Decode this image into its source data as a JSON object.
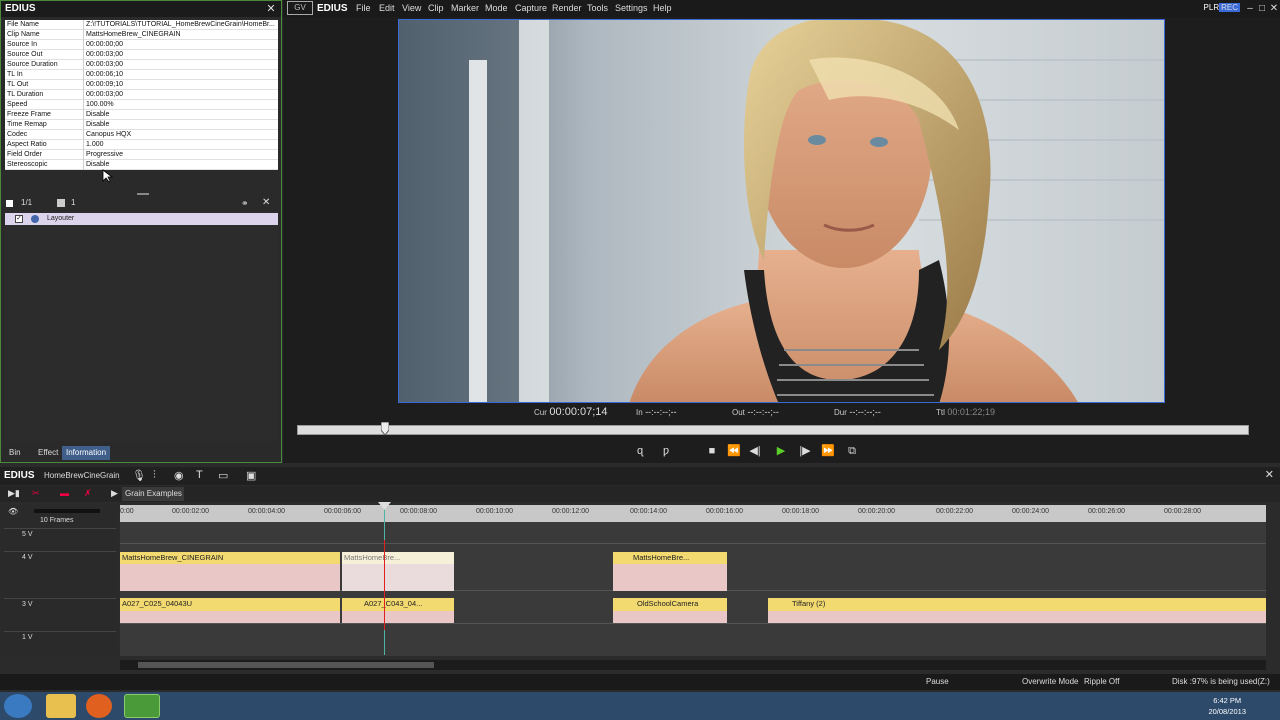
{
  "info": {
    "title": "EDIUS",
    "close": "✕",
    "rows": [
      {
        "key": "File Name",
        "value": "Z:\\!TUTORIALS\\TUTORIAL_HomeBrewCineGrain\\HomeBr..."
      },
      {
        "key": "Clip Name",
        "value": "MattsHomeBrew_CINEGRAIN"
      },
      {
        "key": "Source In",
        "value": "00:00:00;00"
      },
      {
        "key": "Source Out",
        "value": "00:00:03;00"
      },
      {
        "key": "Source Duration",
        "value": "00:00:03;00"
      },
      {
        "key": "TL In",
        "value": "00:00:06;10"
      },
      {
        "key": "TL Out",
        "value": "00:00:09;10"
      },
      {
        "key": "TL Duration",
        "value": "00:00:03;00"
      },
      {
        "key": "Speed",
        "value": "100.00%"
      },
      {
        "key": "Freeze Frame",
        "value": "Disable"
      },
      {
        "key": "Time Remap",
        "value": "Disable"
      },
      {
        "key": "Codec",
        "value": "Canopus HQX"
      },
      {
        "key": "Aspect Ratio",
        "value": "1.000"
      },
      {
        "key": "Field Order",
        "value": "Progressive"
      },
      {
        "key": "Stereoscopic",
        "value": "Disable"
      }
    ]
  },
  "effects": {
    "page": "1/1",
    "count": "1",
    "item": "Layouter"
  },
  "left_tabs": [
    "Bin",
    "Effect",
    "Information"
  ],
  "menubar": {
    "logo": "GV",
    "app": "EDIUS",
    "items": [
      "File",
      "Edit",
      "View",
      "Clip",
      "Marker",
      "Mode",
      "Capture",
      "Render",
      "Tools",
      "Settings",
      "Help"
    ],
    "plr": "PLR",
    "rec": "REC"
  },
  "timecode": {
    "cur_label": "Cur",
    "cur": "00:00:07;14",
    "in_label": "In",
    "in": "--:--:--;--",
    "out_label": "Out",
    "out": "--:--:--;--",
    "dur_label": "Dur",
    "dur": "--:--:--;--",
    "ttl_label": "Ttl",
    "ttl": "00:01:22;19"
  },
  "timeline": {
    "name": "EDIUS",
    "sequence": "HomeBrewCineGrain_...",
    "seq_tab": "Grain Examples",
    "scale": "10 Frames",
    "ruler": [
      "00:00:00:00",
      "00:00:02:00",
      "00:00:04:00",
      "00:00:06:00",
      "00:00:08:00",
      "00:00:10:00",
      "00:00:12:00",
      "00:00:14:00",
      "00:00:16:00",
      "00:00:18:00",
      "00:00:20:00",
      "00:00:22:00",
      "00:00:24:00",
      "00:00:26:00",
      "00:00:28:00"
    ],
    "ruler_short": [
      "0:00",
      "00:00:02:00",
      "00:00:04:00",
      "00:00:06:00",
      "00:00:08:00",
      "00:00:10:00",
      "00:00:12:00",
      "00:00:14:00",
      "00:00:16:00",
      "00:00:18:00",
      "00:00:20:00",
      "00:00:22:00",
      "00:00:24:00",
      "00:00:26:00",
      "00:00:28:00"
    ],
    "tracks": [
      "5 V",
      "4 V",
      "3 V",
      "1 V"
    ],
    "clips": {
      "c1": "MattsHomeBrew_CINEGRAIN",
      "c2": "MattsHomeBre...",
      "c3": "MattsHomeBre...",
      "c4": "A027_C025_04043U",
      "c5": "A027_C043_04...",
      "c6": "OldSchoolCamera",
      "c7": "Tiffany (2)"
    }
  },
  "status": {
    "pause": "Pause",
    "mode": "Overwrite Mode",
    "ripple": "Ripple Off",
    "disk": "Disk :97% is being used(Z:)"
  },
  "clock": {
    "time": "6:42 PM",
    "date": "20/08/2013"
  }
}
